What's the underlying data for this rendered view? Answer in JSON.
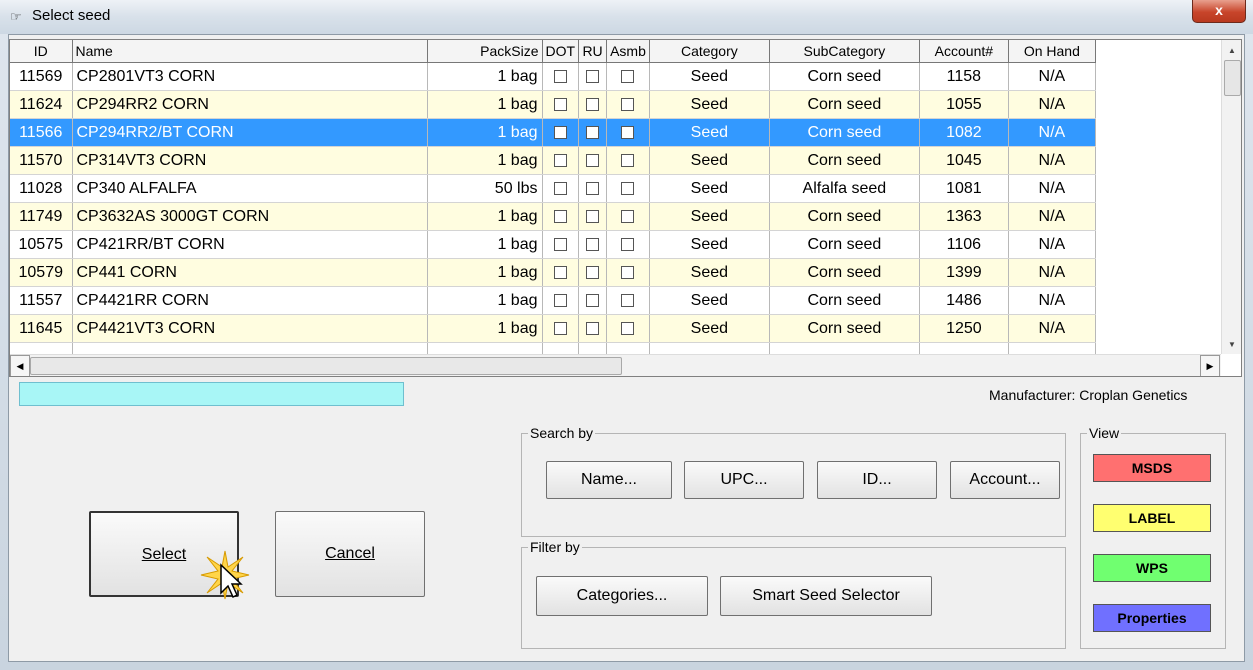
{
  "window": {
    "title": "Select seed",
    "close_label": "x"
  },
  "table": {
    "columns": [
      "ID",
      "Name",
      "PackSize",
      "DOT",
      "RU",
      "Asmb",
      "Category",
      "SubCategory",
      "Account#",
      "On Hand"
    ],
    "rows": [
      {
        "id": "11569",
        "name": "CP2801VT3 CORN",
        "pack": "1 bag",
        "category": "Seed",
        "sub": "Corn seed",
        "account": "1158",
        "onhand": "N/A",
        "style": "white"
      },
      {
        "id": "11624",
        "name": "CP294RR2 CORN",
        "pack": "1 bag",
        "category": "Seed",
        "sub": "Corn seed",
        "account": "1055",
        "onhand": "N/A",
        "style": "yellow"
      },
      {
        "id": "11566",
        "name": "CP294RR2/BT CORN",
        "pack": "1 bag",
        "category": "Seed",
        "sub": "Corn seed",
        "account": "1082",
        "onhand": "N/A",
        "style": "sel"
      },
      {
        "id": "11570",
        "name": "CP314VT3 CORN",
        "pack": "1 bag",
        "category": "Seed",
        "sub": "Corn seed",
        "account": "1045",
        "onhand": "N/A",
        "style": "yellow"
      },
      {
        "id": "11028",
        "name": "CP340 ALFALFA",
        "pack": "50 lbs",
        "category": "Seed",
        "sub": "Alfalfa seed",
        "account": "1081",
        "onhand": "N/A",
        "style": "white"
      },
      {
        "id": "11749",
        "name": "CP3632AS 3000GT CORN",
        "pack": "1 bag",
        "category": "Seed",
        "sub": "Corn seed",
        "account": "1363",
        "onhand": "N/A",
        "style": "yellow"
      },
      {
        "id": "10575",
        "name": "CP421RR/BT CORN",
        "pack": "1 bag",
        "category": "Seed",
        "sub": "Corn seed",
        "account": "1106",
        "onhand": "N/A",
        "style": "white"
      },
      {
        "id": "10579",
        "name": "CP441 CORN",
        "pack": "1 bag",
        "category": "Seed",
        "sub": "Corn seed",
        "account": "1399",
        "onhand": "N/A",
        "style": "yellow"
      },
      {
        "id": "11557",
        "name": "CP4421RR CORN",
        "pack": "1 bag",
        "category": "Seed",
        "sub": "Corn seed",
        "account": "1486",
        "onhand": "N/A",
        "style": "white"
      },
      {
        "id": "11645",
        "name": "CP4421VT3 CORN",
        "pack": "1 bag",
        "category": "Seed",
        "sub": "Corn seed",
        "account": "1250",
        "onhand": "N/A",
        "style": "yellow"
      }
    ]
  },
  "search": {
    "value": ""
  },
  "manufacturer": "Manufacturer: Croplan Genetics",
  "buttons": {
    "select_label": "Select",
    "cancel_label": "Cancel"
  },
  "search_by": {
    "label": "Search by",
    "name": "Name...",
    "upc": "UPC...",
    "id": "ID...",
    "account": "Account..."
  },
  "filter_by": {
    "label": "Filter by",
    "categories": "Categories...",
    "smart": "Smart Seed Selector"
  },
  "view": {
    "label": "View",
    "items": [
      {
        "label": "MSDS",
        "color": "#ff7070"
      },
      {
        "label": "LABEL",
        "color": "#ffff70"
      },
      {
        "label": "WPS",
        "color": "#70ff70"
      },
      {
        "label": "Properties",
        "color": "#7070ff"
      }
    ]
  },
  "colors": {
    "selected_row": "#3399ff",
    "alt_row": "#fffde0",
    "search_box": "#a8f6f6"
  }
}
